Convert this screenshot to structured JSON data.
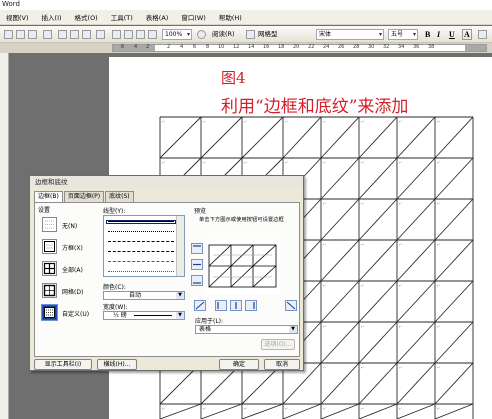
{
  "window": {
    "title": "Word"
  },
  "menu": [
    "视图(V)",
    "插入(I)",
    "格式(O)",
    "工具(T)",
    "表格(A)",
    "窗口(W)",
    "帮助(H)"
  ],
  "toolbar": {
    "zoom": "100%",
    "read_label": "阅读(R)",
    "grid_label": "网格型",
    "font": "宋体",
    "size": "五号",
    "bold": "B",
    "italic": "I",
    "underline": "U",
    "font_color": "A"
  },
  "ruler": {
    "numbers": [
      "6",
      "4",
      "2",
      "2",
      "4",
      "6",
      "8",
      "10",
      "12",
      "14",
      "16",
      "18",
      "20",
      "22",
      "24",
      "26",
      "28",
      "30",
      "32",
      "34",
      "36",
      "38"
    ]
  },
  "document": {
    "heading1": "图4",
    "heading2": "利用“边框和底纹”来添加"
  },
  "dialog": {
    "title": "边框和底纹",
    "tabs": [
      "边框(B)",
      "页面边框(P)",
      "底纹(S)"
    ],
    "settings_label": "设置",
    "settings": [
      "无(N)",
      "方框(X)",
      "全部(A)",
      "网格(D)",
      "自定义(U)"
    ],
    "line_style_label": "线型(Y):",
    "color_label": "颜色(C):",
    "color_value": "自动",
    "width_label": "宽度(W):",
    "width_value": "½ 磅",
    "preview_label": "预览",
    "preview_hint": "单击下方图示或使用按钮可设置边框",
    "apply_label": "应用于(L):",
    "apply_value": "表格",
    "options_button": "选项(O)...",
    "toolbar_button": "显示工具栏(I)",
    "hline_button": "横线(H)...",
    "ok_button": "确定",
    "cancel_button": "取消"
  }
}
